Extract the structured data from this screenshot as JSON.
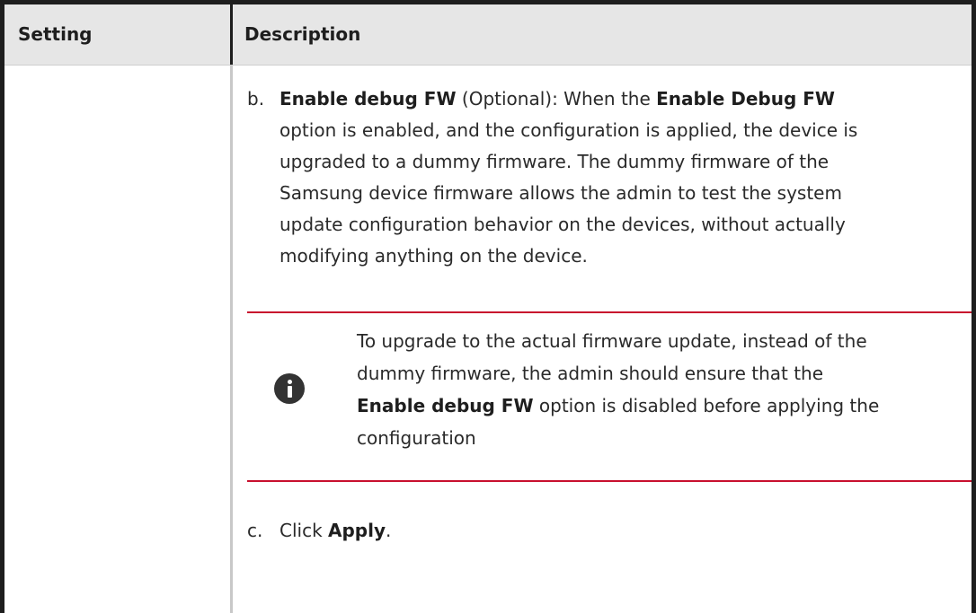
{
  "table": {
    "headers": {
      "setting": "Setting",
      "description": "Description"
    }
  },
  "steps": {
    "b": {
      "marker": "b.",
      "lines": [
        [
          "Enable debug FW",
          " (Optional): When the ",
          "Enable Debug FW"
        ],
        "option is enabled, and the configuration is applied, the device is",
        "upgraded to a dummy firmware. The dummy firmware of the",
        "Samsung device firmware allows the admin to test the system",
        "update configuration behavior on the devices, without actually",
        "modifying anything on the device."
      ]
    },
    "c": {
      "marker": "c.",
      "prefix": "Click ",
      "bold": "Apply",
      "suffix": "."
    }
  },
  "note": {
    "icon": "info-icon",
    "accent_color": "#c8102e",
    "line1": "To upgrade to the actual firmware update, instead of the",
    "line2": "dummy firmware, the admin should ensure that the",
    "line3_bold": "Enable debug FW",
    "line3_rest": " option is disabled before applying the",
    "line4": "configuration"
  }
}
